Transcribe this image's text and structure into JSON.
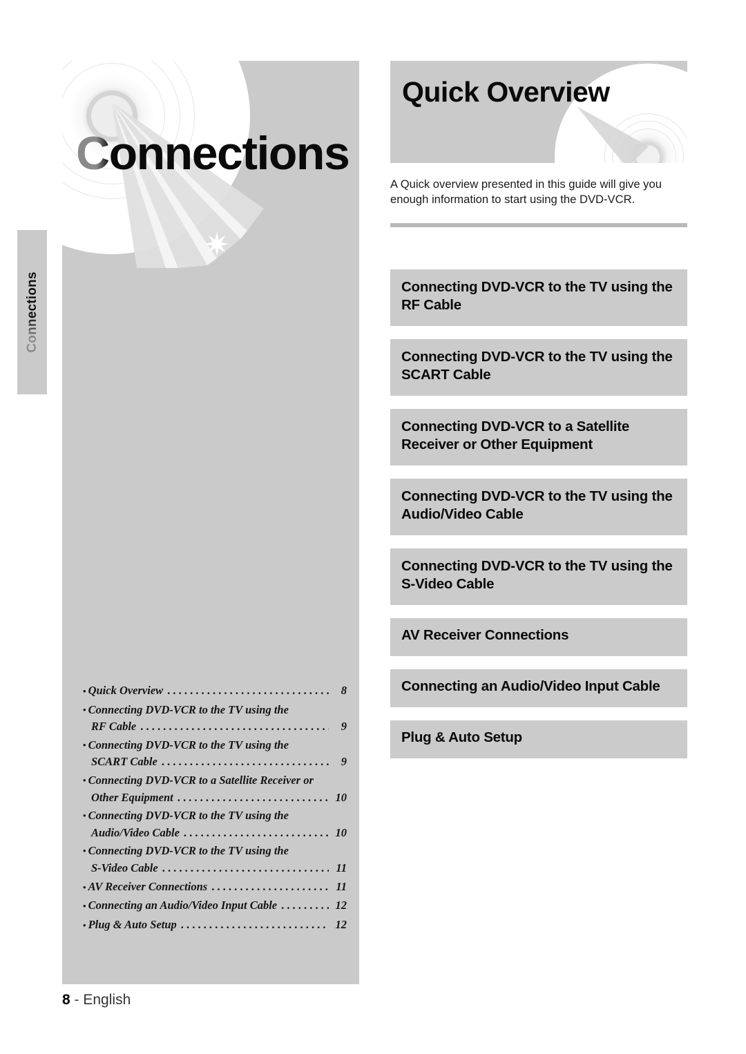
{
  "side_tab": {
    "label": "Connections"
  },
  "left_panel": {
    "title": "Connections",
    "disc_icon": "dvd-disc-icon",
    "laser_icon": "laser-sparkle-icon",
    "toc": [
      {
        "text": "Quick Overview",
        "lines": [
          "Quick Overview"
        ],
        "page": "8"
      },
      {
        "text": "Connecting DVD-VCR to the TV using the RF Cable",
        "lines": [
          "Connecting DVD-VCR to the TV using the",
          "RF Cable"
        ],
        "page": "9"
      },
      {
        "text": "Connecting DVD-VCR to the TV using the SCART Cable",
        "lines": [
          "Connecting DVD-VCR to the TV using the",
          "SCART Cable"
        ],
        "page": "9"
      },
      {
        "text": "Connecting DVD-VCR to a Satellite Receiver or Other Equipment",
        "lines": [
          "Connecting DVD-VCR to a Satellite Receiver or",
          "Other Equipment"
        ],
        "page": "10"
      },
      {
        "text": "Connecting DVD-VCR to the TV using the Audio/Video Cable",
        "lines": [
          "Connecting DVD-VCR to the TV using the",
          "Audio/Video Cable"
        ],
        "page": "10"
      },
      {
        "text": "Connecting DVD-VCR to the TV using the S-Video Cable",
        "lines": [
          "Connecting DVD-VCR to the TV using the",
          "S-Video Cable"
        ],
        "page": "11"
      },
      {
        "text": "AV Receiver Connections",
        "lines": [
          "AV Receiver Connections"
        ],
        "page": "11"
      },
      {
        "text": "Connecting an Audio/Video Input Cable",
        "lines": [
          "Connecting an Audio/Video Input Cable"
        ],
        "page": "12"
      },
      {
        "text": "Plug & Auto Setup",
        "lines": [
          "Plug & Auto Setup"
        ],
        "page": "12"
      }
    ],
    "bullet": "•",
    "leader": "................................................................"
  },
  "right_col": {
    "header_title": "Quick Overview",
    "disc_icon": "dvd-disc-icon",
    "intro": "A Quick overview presented in this guide will give you enough information to start using the DVD-VCR.",
    "sections": [
      {
        "label": "Connecting DVD-VCR to the TV using the RF Cable",
        "lines": 2
      },
      {
        "label": "Connecting DVD-VCR to the TV using the SCART Cable",
        "lines": 2
      },
      {
        "label": "Connecting DVD-VCR to a Satellite Receiver or Other Equipment",
        "lines": 2
      },
      {
        "label": "Connecting DVD-VCR to the TV using the Audio/Video Cable",
        "lines": 2
      },
      {
        "label": "Connecting DVD-VCR to the TV using the S-Video Cable",
        "lines": 2
      },
      {
        "label": "AV Receiver Connections",
        "lines": 1
      },
      {
        "label": "Connecting an Audio/Video Input Cable",
        "lines": 1
      },
      {
        "label": "Plug & Auto Setup",
        "lines": 1
      }
    ]
  },
  "footer": {
    "page_number": "8",
    "separator": "-",
    "language": "English"
  },
  "colors": {
    "panel_gray": "#cacaca",
    "box_gray": "#cbcbcb",
    "rule_gray": "#b9b9b9",
    "text_black": "#0a0a0a",
    "page_white": "#ffffff"
  }
}
